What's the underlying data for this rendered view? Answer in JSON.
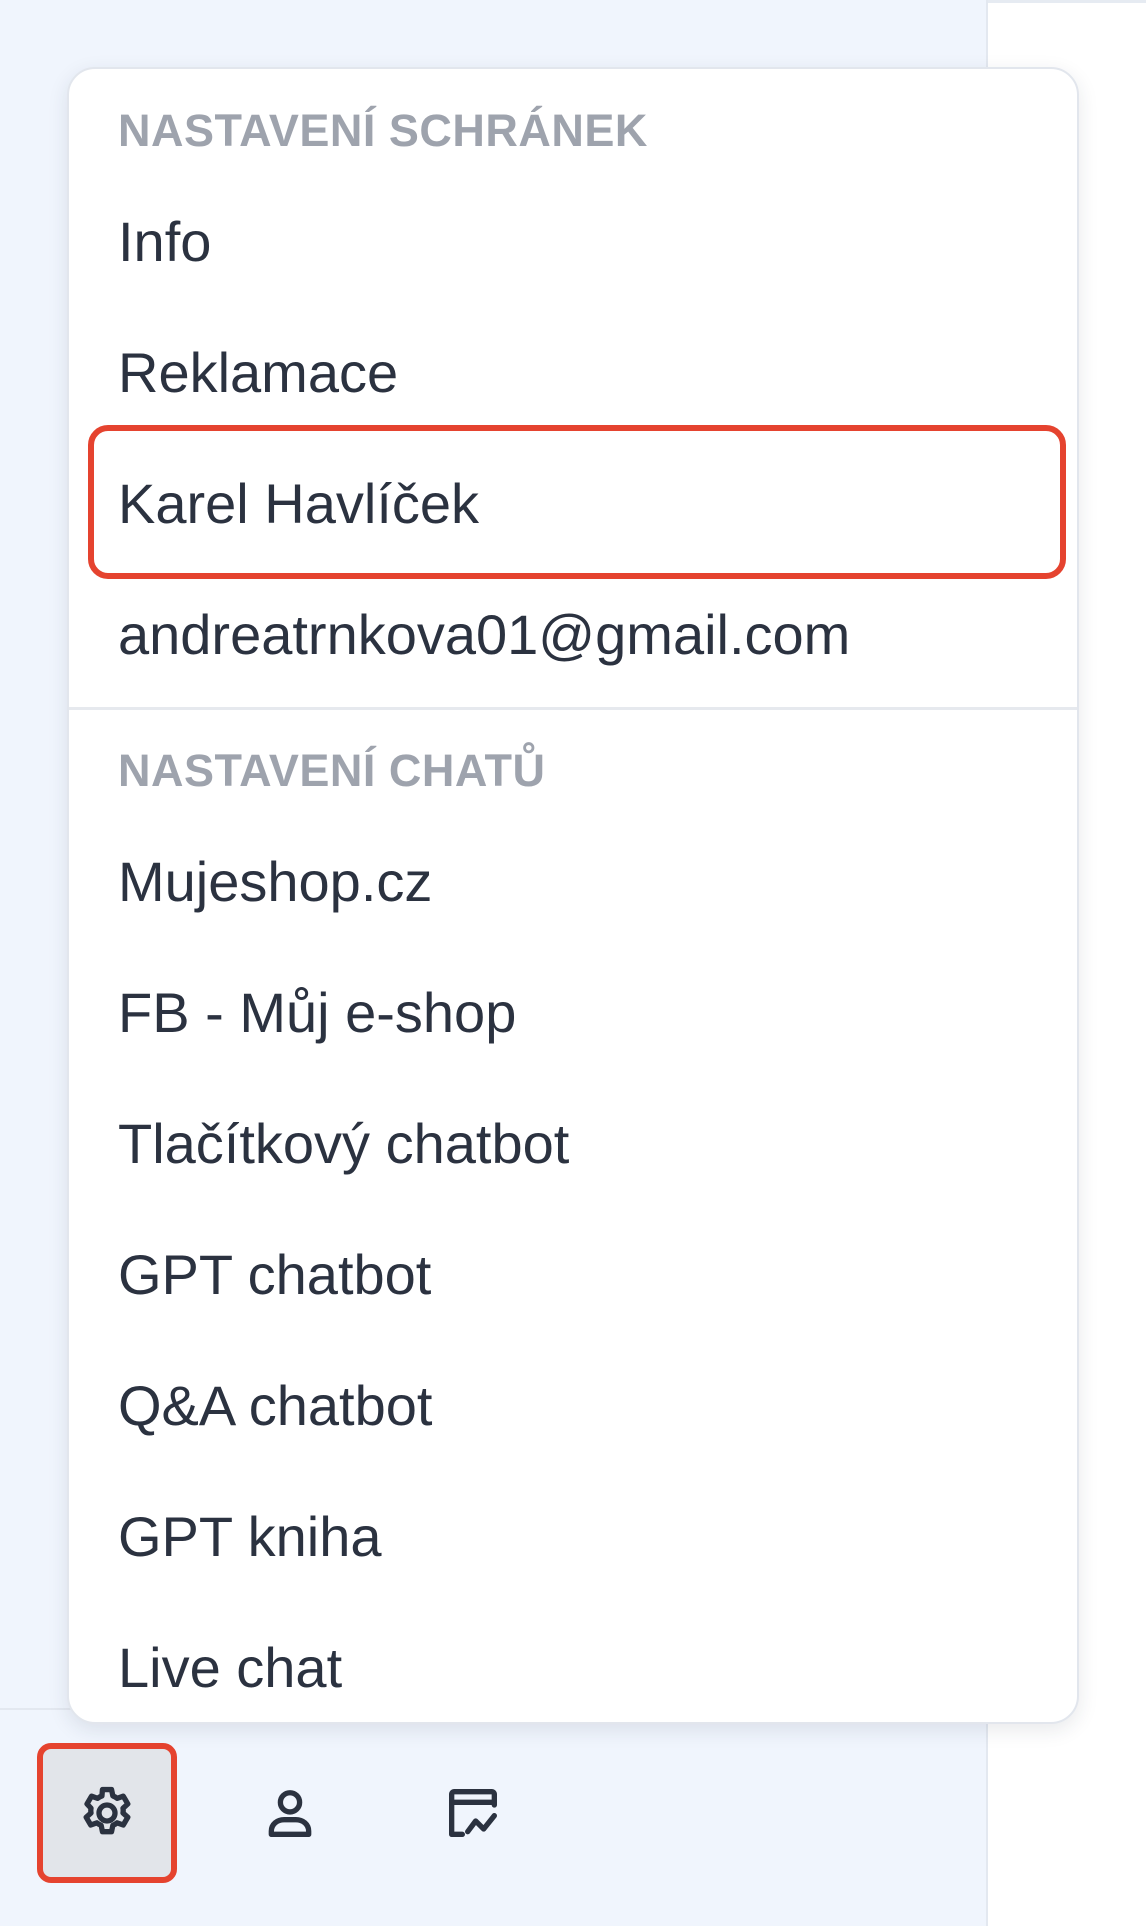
{
  "dropdown": {
    "mailbox_section": {
      "label": "NASTAVENÍ SCHRÁNEK",
      "items": [
        {
          "label": "Info"
        },
        {
          "label": "Reklamace"
        },
        {
          "label": "Karel Havlíček",
          "highlighted": true
        },
        {
          "label": "andreatrnkova01@gmail.com"
        }
      ]
    },
    "chat_section": {
      "label": "NASTAVENÍ CHATŮ",
      "items": [
        {
          "label": "Mujeshop.cz"
        },
        {
          "label": "FB - Můj e-shop"
        },
        {
          "label": "Tlačítkový chatbot"
        },
        {
          "label": "GPT chatbot"
        },
        {
          "label": "Q&A chatbot"
        },
        {
          "label": "GPT kniha"
        },
        {
          "label": "Live chat"
        }
      ]
    }
  },
  "bottom_bar": {
    "buttons": [
      {
        "icon": "gear-icon",
        "active": true
      },
      {
        "icon": "user-icon",
        "active": false
      },
      {
        "icon": "signature-icon",
        "active": false
      }
    ]
  },
  "colors": {
    "highlight": "#e5432f",
    "panel_bg": "#f0f5fd",
    "text": "#2b3240",
    "section_label": "#9ea3ad"
  }
}
